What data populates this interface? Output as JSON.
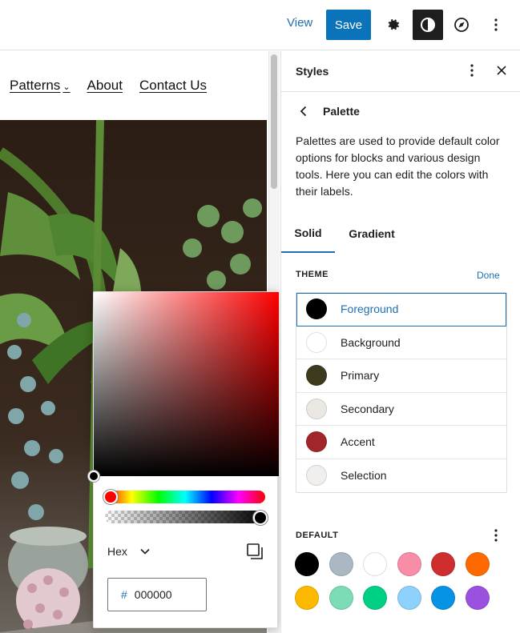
{
  "toolbar": {
    "view_label": "View",
    "save_label": "Save",
    "settings_icon": "gear-icon",
    "styles_icon": "contrast-icon",
    "navigation_icon": "compass-icon",
    "options_icon": "more-vertical-icon"
  },
  "site_nav": {
    "items": [
      "Patterns",
      "About",
      "Contact Us"
    ]
  },
  "color_picker": {
    "format_label": "Hex",
    "hex_prefix": "#",
    "hex_value": "000000",
    "copy_icon": "copy-icon"
  },
  "styles_panel": {
    "title": "Styles",
    "subtitle": "Palette",
    "description": "Palettes are used to provide default color options for blocks and various design tools. Here you can edit the colors with their labels.",
    "tabs": [
      "Solid",
      "Gradient"
    ],
    "theme_label": "THEME",
    "done_label": "Done",
    "theme_colors": [
      {
        "name": "Foreground",
        "color": "#000000"
      },
      {
        "name": "Background",
        "color": "#ffffff"
      },
      {
        "name": "Primary",
        "color": "#3d3a1e"
      },
      {
        "name": "Secondary",
        "color": "#ebe8e4"
      },
      {
        "name": "Accent",
        "color": "#a1262b"
      },
      {
        "name": "Selection",
        "color": "#f0efee"
      }
    ],
    "default_label": "DEFAULT",
    "default_colors": [
      "#000000",
      "#abb8c3",
      "#ffffff",
      "#f78da7",
      "#cf2e2e",
      "#ff6900",
      "#fcb900",
      "#7bdcb5",
      "#00d084",
      "#8ed1fc",
      "#0693e3",
      "#9b51e0"
    ]
  },
  "colors": {
    "accent": "#0a73b9",
    "link": "#1e6fb5"
  }
}
